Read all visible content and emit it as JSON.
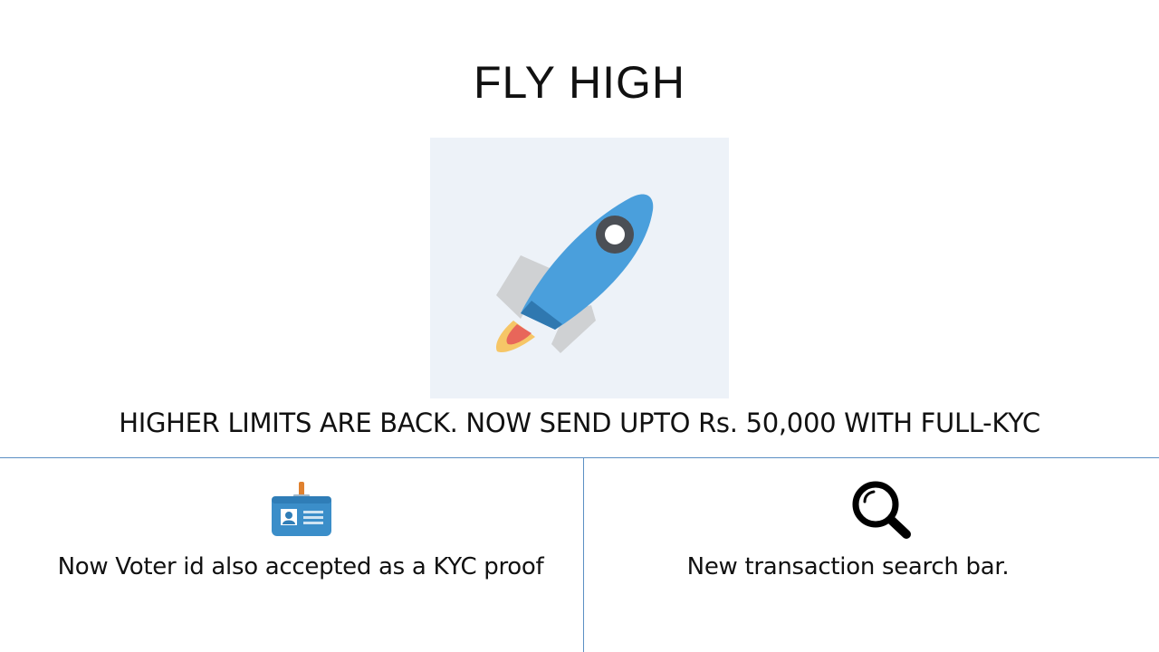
{
  "title": "FLY HIGH",
  "hero": {
    "icon": "rocket-icon"
  },
  "headline": "HIGHER LIMITS ARE BACK. NOW SEND UPTO Rs. 50,000 WITH FULL-KYC",
  "features": [
    {
      "icon": "id-card-icon",
      "text": "Now Voter id also accepted as a KYC proof"
    },
    {
      "icon": "search-icon",
      "text": "New transaction search bar."
    }
  ],
  "colors": {
    "divider": "#5b8fc4",
    "hero_background": "#edf2f8",
    "rocket_body": "#4a9fdc",
    "rocket_fins": "#cfd1d3",
    "flame_outer": "#f6c667",
    "flame_inner": "#e8665a",
    "id_card": "#3b8ec9"
  }
}
